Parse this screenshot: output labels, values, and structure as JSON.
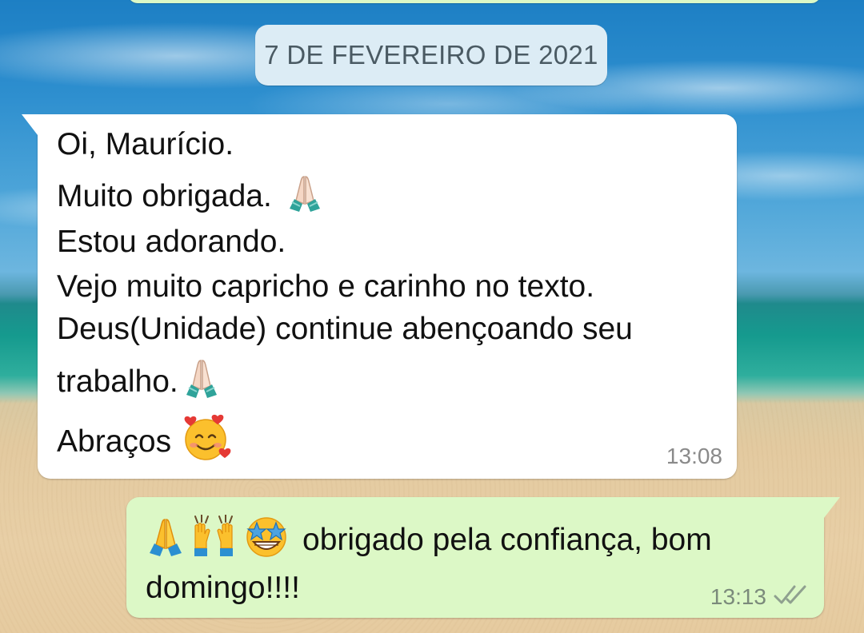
{
  "chat": {
    "date_separator": "7 DE FEVEREIRO DE 2021",
    "incoming": {
      "lines": [
        "Oi, Maurício.",
        "Muito obrigada.",
        "Estou adorando.",
        "Vejo muito capricho e carinho no texto.",
        "Deus(Unidade) continue abençoando seu",
        "trabalho.",
        "Abraços"
      ],
      "time": "13:08",
      "emojis": [
        "folded-hands-icon",
        "folded-hands-icon",
        "smiling-face-with-hearts-icon"
      ]
    },
    "outgoing": {
      "lines": [
        "obrigado pela confiança, bom",
        "domingo!!!!"
      ],
      "time": "13:13",
      "status": "double-check-read-icon",
      "emojis": [
        "folded-hands-icon",
        "raising-hands-icon",
        "star-struck-icon"
      ]
    }
  },
  "colors": {
    "incoming_bubble": "#ffffff",
    "outgoing_bubble": "#dcf8c6",
    "date_chip": "#dcecf5",
    "text": "#111111",
    "timestamp": "#8a8a8a"
  }
}
